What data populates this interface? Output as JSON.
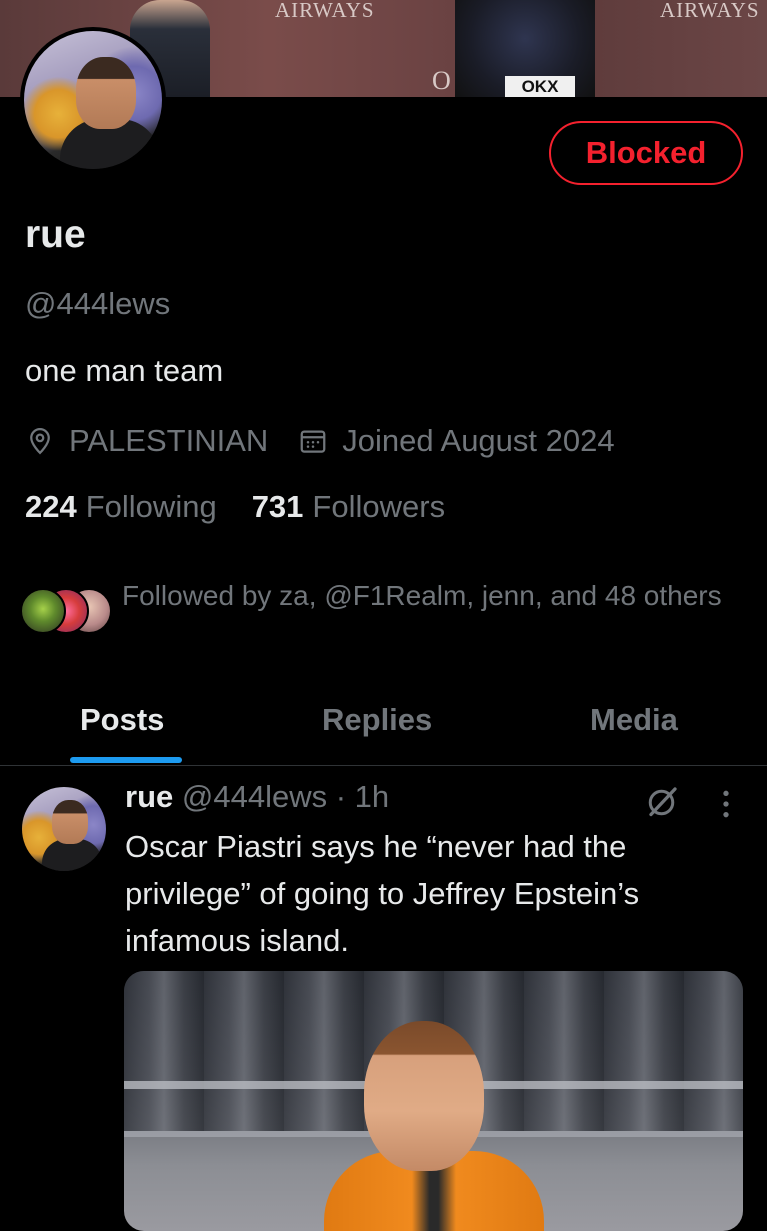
{
  "banner": {
    "airways_left": "AIRWAYS",
    "airways_right": "AIRWAYS",
    "logo_ox": "O",
    "logo_box": "OKX"
  },
  "profile": {
    "name": "rue",
    "handle": "@444lews",
    "bio": "one man team",
    "location": "PALESTINIAN",
    "joined": "Joined August 2024",
    "blocked_label": "Blocked",
    "following_count": "224",
    "following_label": "Following",
    "followers_count": "731",
    "followers_label": "Followers",
    "followed_by": "Followed by za, @F1Realm, jenn, and 48 others"
  },
  "tabs": [
    {
      "label": "Posts",
      "active": true
    },
    {
      "label": "Replies",
      "active": false
    },
    {
      "label": "Media",
      "active": false
    }
  ],
  "post": {
    "name": "rue",
    "handle": "@444lews",
    "time": "· 1h",
    "text": "Oscar Piastri says he “never had the privilege” of going to Jeffrey Epstein’s infamous island."
  },
  "colors": {
    "background": "#000000",
    "text_primary": "#e7e9ea",
    "text_secondary": "#71767b",
    "blocked_red": "#f4212e",
    "tab_accent": "#1d9bf0"
  }
}
